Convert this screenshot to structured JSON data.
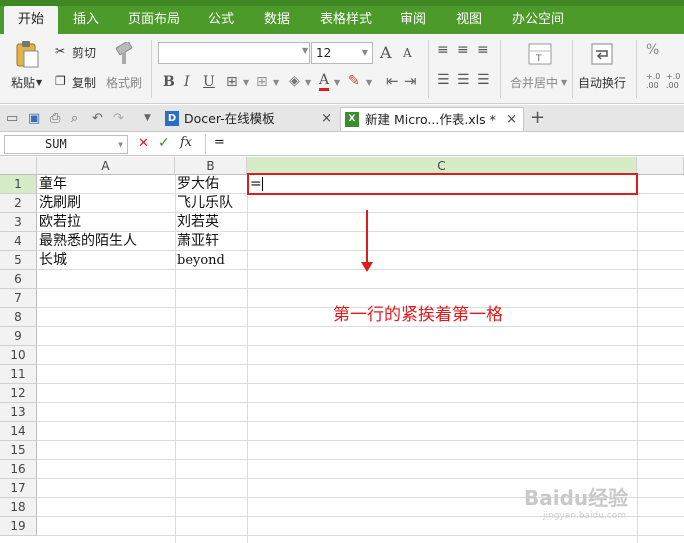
{
  "menu": {
    "items": [
      "开始",
      "插入",
      "页面布局",
      "公式",
      "数据",
      "表格样式",
      "审阅",
      "视图",
      "办公空间"
    ]
  },
  "ribbon": {
    "paste": "粘贴",
    "cut": "剪切",
    "copy": "复制",
    "format_painter": "格式刷",
    "font_size": "12",
    "font_grow": "A",
    "font_shrink": "A",
    "bold": "B",
    "italic": "I",
    "underline": "U",
    "merge_center": "合并居中",
    "wrap_text": "自动换行"
  },
  "tabs": [
    {
      "label": "Docer-在线模板",
      "close": "×"
    },
    {
      "label": "新建 Micro...作表.xls *",
      "close": "×"
    }
  ],
  "new_tab": "+",
  "formula_bar": {
    "name_box": "SUM",
    "cancel": "✕",
    "confirm": "✓",
    "fx": "fx",
    "content": "="
  },
  "sheet": {
    "columns": [
      "A",
      "B",
      "C"
    ],
    "rows": [
      "1",
      "2",
      "3",
      "4",
      "5",
      "6",
      "7",
      "8",
      "9",
      "10",
      "11",
      "12",
      "13",
      "14",
      "15",
      "16",
      "17",
      "18",
      "19"
    ],
    "cells": {
      "A1": "童年",
      "B1": "罗大佑",
      "C1": "=",
      "A2": "洗刷刷",
      "B2": "飞儿乐队",
      "A3": "欧若拉",
      "B3": "刘若英",
      "A4": "最熟悉的陌生人",
      "B4": "萧亚轩",
      "A5": "长城",
      "B5": "beyond"
    }
  },
  "annotation": {
    "text": "第一行的紧挨着第一格",
    "color": "#e01b1b"
  },
  "watermark": {
    "text": "Baidu经验",
    "sub": "jingyan.baidu.com"
  },
  "colors": {
    "menubar": "#4c9a2a",
    "selected_header": "#d6ebc7",
    "highlight_border": "#e01b1b"
  }
}
